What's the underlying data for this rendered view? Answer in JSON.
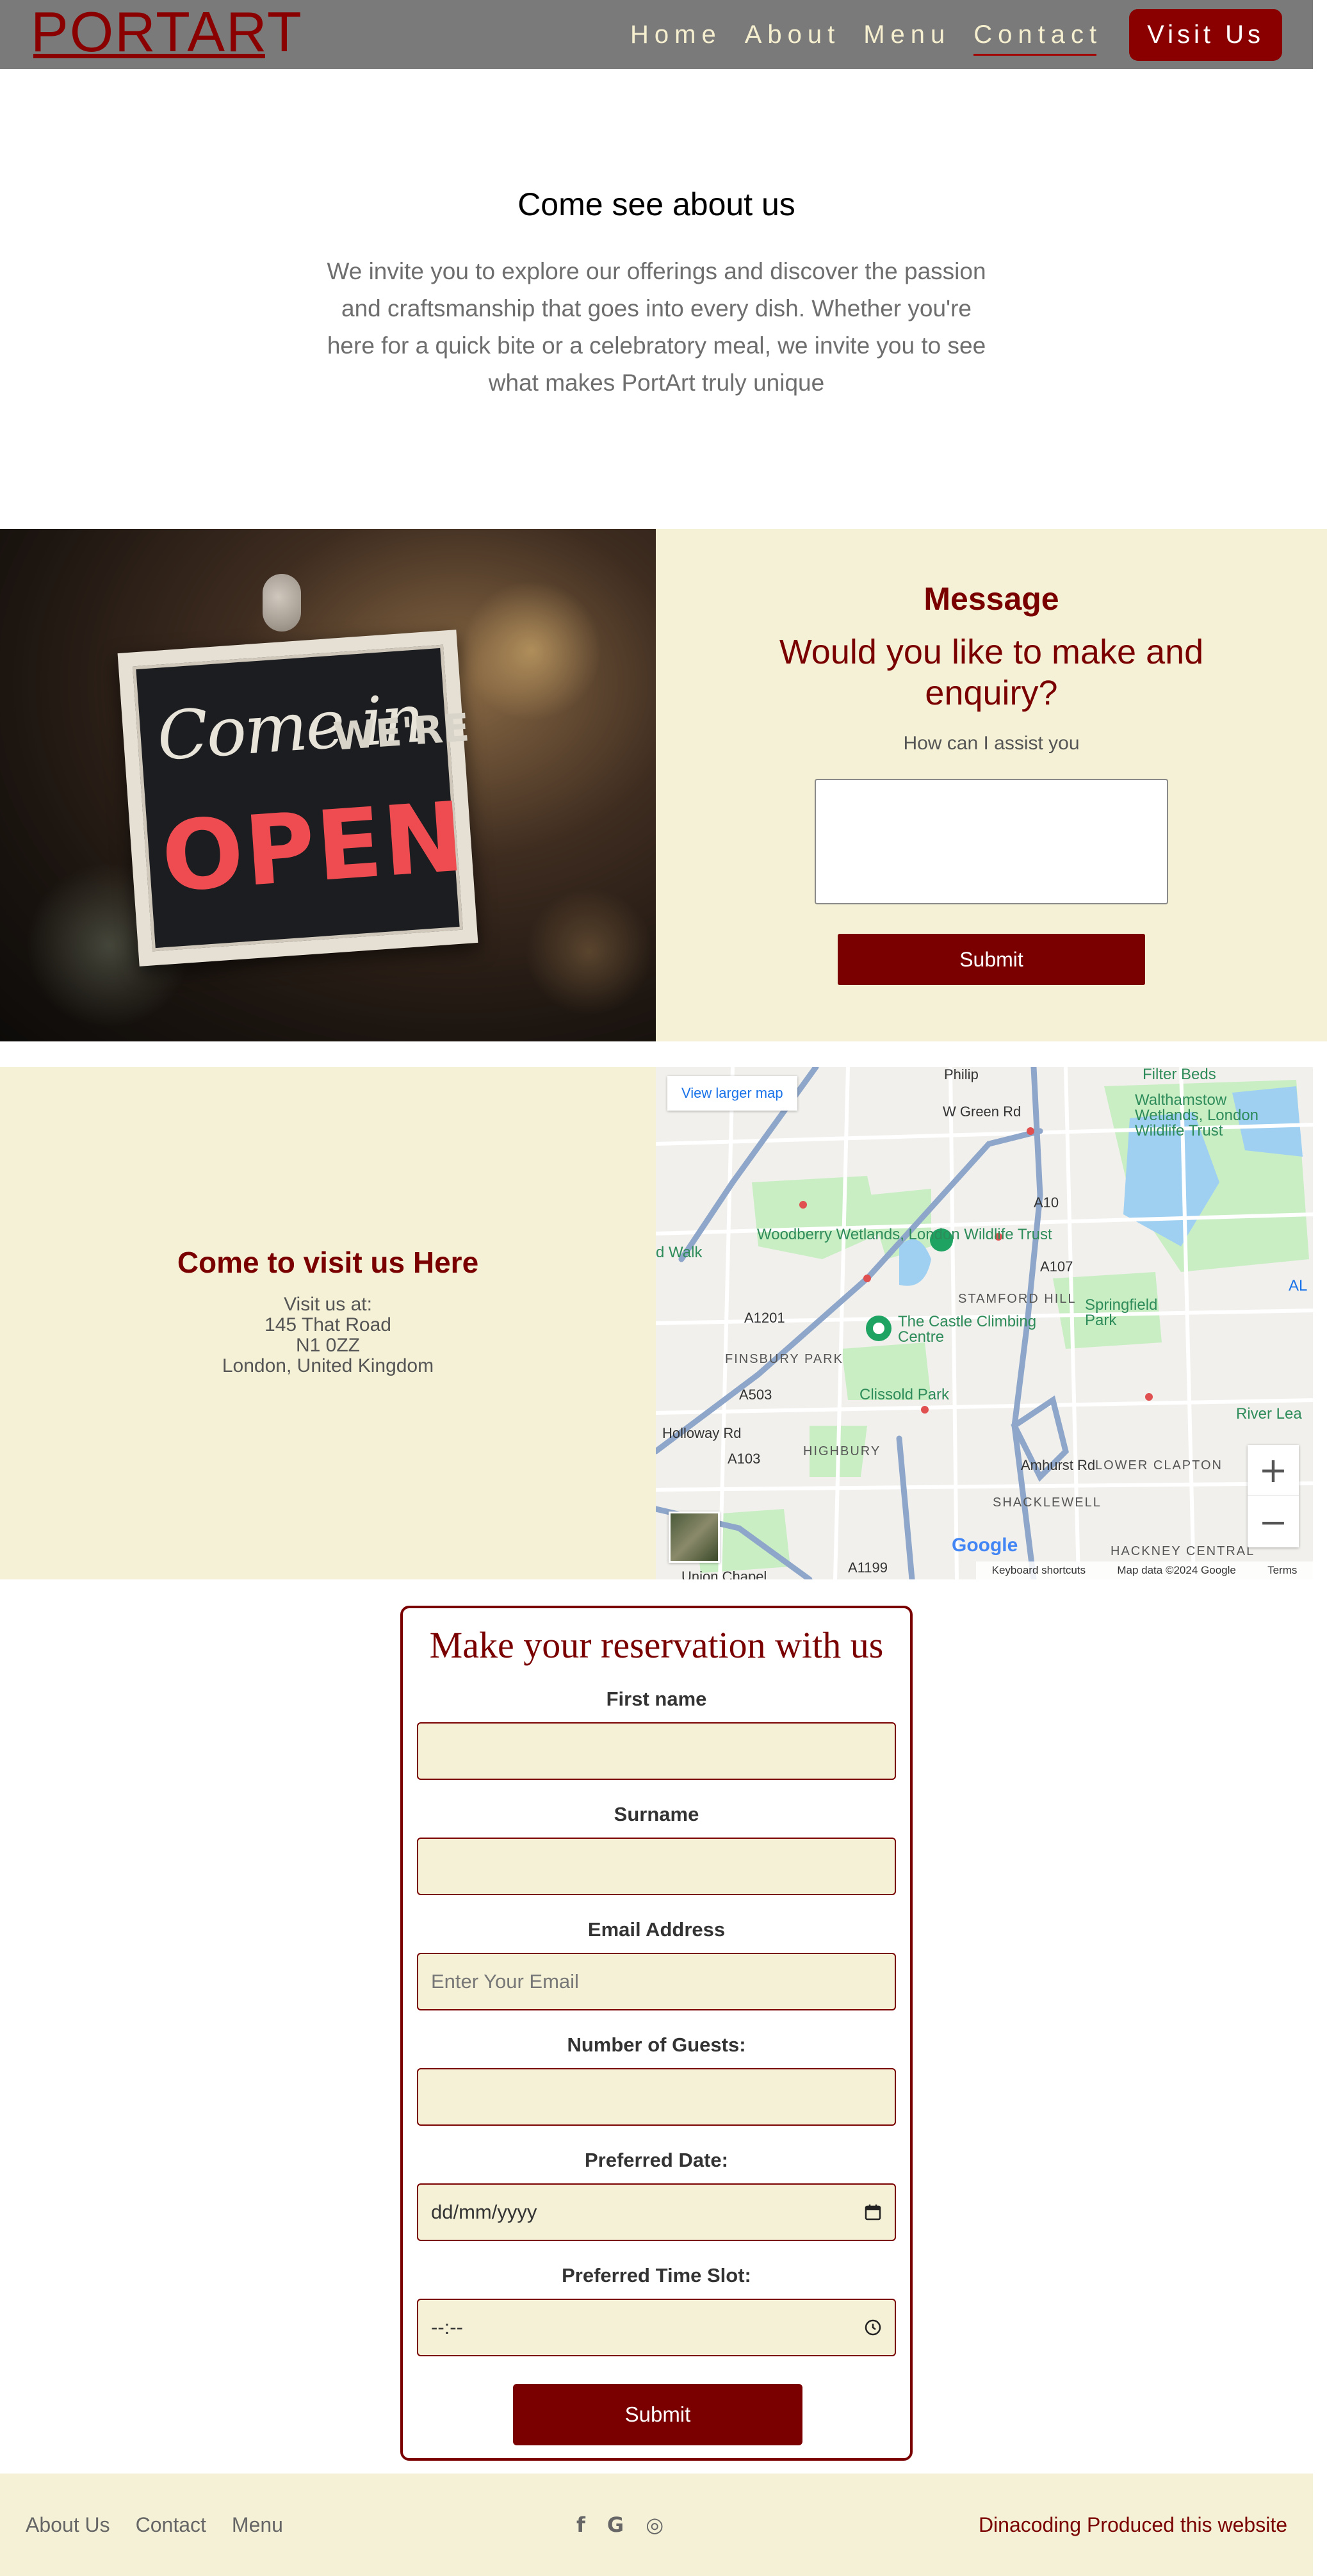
{
  "nav": {
    "logo": "PORTART",
    "links": [
      {
        "label": "Home"
      },
      {
        "label": "About"
      },
      {
        "label": "Menu"
      },
      {
        "label": "Contact"
      }
    ],
    "cta": "Visit Us"
  },
  "intro": {
    "title": "Come see about us",
    "text": "We invite you to explore our offerings and discover the passion and craftsmanship that goes into every dish. Whether you're here for a quick bite or a celebratory meal, we invite you to see what makes PortArt truly unique"
  },
  "sign": {
    "line1": "Come in",
    "line2": "WE'RE",
    "line3": "OPEN"
  },
  "message": {
    "title": "Message",
    "subtitle": "Would you like to make and enquiry?",
    "help": "How can I assist you",
    "submit": "Submit"
  },
  "visit": {
    "title": "Come to visit us Here",
    "lines": [
      "Visit us at:",
      "145 That Road",
      "N1 0ZZ",
      "London, United Kingdom"
    ]
  },
  "map": {
    "larger_link": "View larger map",
    "labels": {
      "woodberry": "Woodberry Wetlands, London Wildlife Trust",
      "walthamstow": "Walthamstow Wetlands, London Wildlife Trust",
      "castle": "The Castle Climbing Centre",
      "clissold": "Clissold Park",
      "springfield": "Springfield Park",
      "finsbury": "FINSBURY PARK",
      "stamford": "STAMFORD HILL",
      "highbury": "HIGHBURY",
      "lower_clapton": "LOWER CLAPTON",
      "shacklewell": "SHACKLEWELL",
      "hackney": "HACKNEY CENTRAL",
      "green_rd": "W Green Rd",
      "a107": "A107",
      "a1201": "A1201",
      "a10": "A10",
      "a503": "A503",
      "a103": "A103",
      "a1199": "A1199",
      "holloway": "Holloway Rd",
      "amhurst": "Amhurst Rd",
      "river_lea": "River Lea",
      "union_chapel": "Union Chapel",
      "filter_beds": "Filter Beds",
      "d_walk": "d Walk",
      "al": "AL",
      "philip": "Philip"
    },
    "zoom_in": "+",
    "zoom_out": "−",
    "google": "Google",
    "footer": [
      "Keyboard shortcuts",
      "Map data ©2024 Google",
      "Terms"
    ]
  },
  "reservation": {
    "title": "Make your reservation with us",
    "fields": [
      {
        "label": "First name",
        "value": "",
        "placeholder": ""
      },
      {
        "label": "Surname",
        "value": "",
        "placeholder": ""
      },
      {
        "label": "Email Address",
        "value": "",
        "placeholder": "Enter Your Email"
      },
      {
        "label": "Number of Guests:",
        "value": "",
        "placeholder": ""
      },
      {
        "label": "Preferred Date:",
        "value": "dd/mm/yyyy",
        "placeholder": ""
      },
      {
        "label": "Preferred Time Slot:",
        "value": "--:--",
        "placeholder": ""
      }
    ],
    "submit": "Submit"
  },
  "footer": {
    "links": [
      "About Us",
      "Contact",
      "Menu"
    ],
    "icons": [
      "facebook-icon",
      "google-icon",
      "instagram-icon"
    ],
    "icon_glyphs": [
      "f",
      "G",
      "◎"
    ],
    "credit": "Dinacoding Produced this website"
  },
  "colors": {
    "brand": "#7a0000",
    "cream": "#f4f1d6",
    "nav": "#7a7a7a"
  }
}
